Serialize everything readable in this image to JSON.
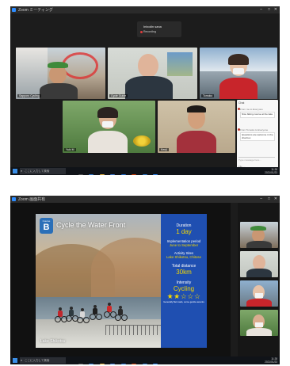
{
  "meeting": {
    "window_title": "Zoom ミーティング",
    "notice_title": "Inbodin sana",
    "notice_sub": "Recording"
  },
  "participants": [
    {
      "name": "Sapporo Cycling"
    },
    {
      "name": "Cycle Guide"
    },
    {
      "name": "Tomoko"
    },
    {
      "name": "Yuki M"
    },
    {
      "name": "Kenji"
    }
  ],
  "chat": {
    "title": "Chat",
    "messages": [
      {
        "from": "From me to Everyone",
        "text": "Nice biking course at the lake"
      },
      {
        "from": "From Tomoko to Everyone",
        "text": "Questions are welcome in the chat box"
      }
    ],
    "input_placeholder": "Type message here...",
    "tools": "File  …"
  },
  "taskbar": {
    "search_placeholder": "ここに入力して検索",
    "time": "11:28",
    "date": "2021/01/23"
  },
  "share": {
    "window_title": "Zoom 画面共有"
  },
  "slide": {
    "badge_top": "Course",
    "badge_letter": "B",
    "title": "Cycle the Water Front",
    "place": "Lake Shikotsu",
    "duration_label": "Duration",
    "duration_value": "1 day",
    "season_label": "Implementation period",
    "season_value": "June to September",
    "site_label": "Activity Sites",
    "site_value": "Lake Shikotsu, Chitose",
    "distance_label": "Total distance",
    "distance_value": "30km",
    "intensity_label": "Intensity",
    "intensity_value": "Cycling",
    "intensity_rating": 2,
    "intensity_max": 5,
    "stars": "★★☆☆☆",
    "footnote": "Generally flat roads, some gentle ascents"
  },
  "colors": {
    "info_panel": "#1f4fb1",
    "info_text": "#f5d800",
    "badge": "#2a6fb8",
    "zoom_bg": "#1c1c1c"
  }
}
